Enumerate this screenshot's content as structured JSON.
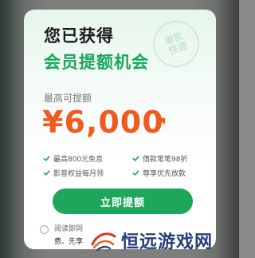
{
  "card": {
    "headline_line1": "您已获得",
    "headline_line2": "会员提额机会",
    "stamp_line1": "审批",
    "stamp_line2": "快速",
    "limit_label": "最高可提额",
    "amount": "¥6,000",
    "benefits": [
      "最高800元免息",
      "借款笔笔98折",
      "影音权益每月领",
      "尊享优先放款"
    ],
    "cta_label": "立即提额",
    "agreement_line1": "阅读即同",
    "agreement_line2": "费、先享"
  },
  "watermark": {
    "text": "恒远游戏网"
  },
  "colors": {
    "accent_green": "#1ca75c",
    "amount_orange": "#f05a1e",
    "watermark_blue": "#223f7a"
  }
}
